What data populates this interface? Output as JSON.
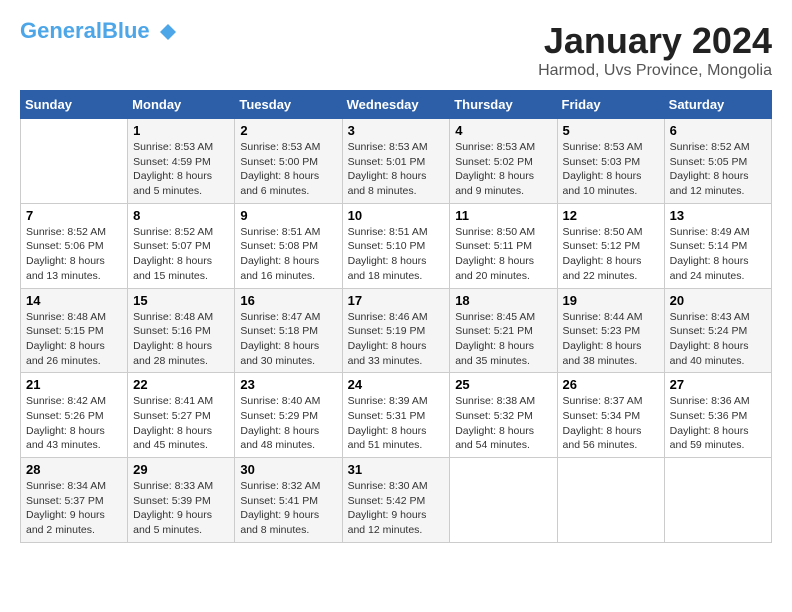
{
  "header": {
    "logo_general": "General",
    "logo_blue": "Blue",
    "logo_tagline": "",
    "month_title": "January 2024",
    "location": "Harmod, Uvs Province, Mongolia"
  },
  "calendar": {
    "days_of_week": [
      "Sunday",
      "Monday",
      "Tuesday",
      "Wednesday",
      "Thursday",
      "Friday",
      "Saturday"
    ],
    "weeks": [
      [
        {
          "day": "",
          "content": ""
        },
        {
          "day": "1",
          "content": "Sunrise: 8:53 AM\nSunset: 4:59 PM\nDaylight: 8 hours\nand 5 minutes."
        },
        {
          "day": "2",
          "content": "Sunrise: 8:53 AM\nSunset: 5:00 PM\nDaylight: 8 hours\nand 6 minutes."
        },
        {
          "day": "3",
          "content": "Sunrise: 8:53 AM\nSunset: 5:01 PM\nDaylight: 8 hours\nand 8 minutes."
        },
        {
          "day": "4",
          "content": "Sunrise: 8:53 AM\nSunset: 5:02 PM\nDaylight: 8 hours\nand 9 minutes."
        },
        {
          "day": "5",
          "content": "Sunrise: 8:53 AM\nSunset: 5:03 PM\nDaylight: 8 hours\nand 10 minutes."
        },
        {
          "day": "6",
          "content": "Sunrise: 8:52 AM\nSunset: 5:05 PM\nDaylight: 8 hours\nand 12 minutes."
        }
      ],
      [
        {
          "day": "7",
          "content": "Sunrise: 8:52 AM\nSunset: 5:06 PM\nDaylight: 8 hours\nand 13 minutes."
        },
        {
          "day": "8",
          "content": "Sunrise: 8:52 AM\nSunset: 5:07 PM\nDaylight: 8 hours\nand 15 minutes."
        },
        {
          "day": "9",
          "content": "Sunrise: 8:51 AM\nSunset: 5:08 PM\nDaylight: 8 hours\nand 16 minutes."
        },
        {
          "day": "10",
          "content": "Sunrise: 8:51 AM\nSunset: 5:10 PM\nDaylight: 8 hours\nand 18 minutes."
        },
        {
          "day": "11",
          "content": "Sunrise: 8:50 AM\nSunset: 5:11 PM\nDaylight: 8 hours\nand 20 minutes."
        },
        {
          "day": "12",
          "content": "Sunrise: 8:50 AM\nSunset: 5:12 PM\nDaylight: 8 hours\nand 22 minutes."
        },
        {
          "day": "13",
          "content": "Sunrise: 8:49 AM\nSunset: 5:14 PM\nDaylight: 8 hours\nand 24 minutes."
        }
      ],
      [
        {
          "day": "14",
          "content": "Sunrise: 8:48 AM\nSunset: 5:15 PM\nDaylight: 8 hours\nand 26 minutes."
        },
        {
          "day": "15",
          "content": "Sunrise: 8:48 AM\nSunset: 5:16 PM\nDaylight: 8 hours\nand 28 minutes."
        },
        {
          "day": "16",
          "content": "Sunrise: 8:47 AM\nSunset: 5:18 PM\nDaylight: 8 hours\nand 30 minutes."
        },
        {
          "day": "17",
          "content": "Sunrise: 8:46 AM\nSunset: 5:19 PM\nDaylight: 8 hours\nand 33 minutes."
        },
        {
          "day": "18",
          "content": "Sunrise: 8:45 AM\nSunset: 5:21 PM\nDaylight: 8 hours\nand 35 minutes."
        },
        {
          "day": "19",
          "content": "Sunrise: 8:44 AM\nSunset: 5:23 PM\nDaylight: 8 hours\nand 38 minutes."
        },
        {
          "day": "20",
          "content": "Sunrise: 8:43 AM\nSunset: 5:24 PM\nDaylight: 8 hours\nand 40 minutes."
        }
      ],
      [
        {
          "day": "21",
          "content": "Sunrise: 8:42 AM\nSunset: 5:26 PM\nDaylight: 8 hours\nand 43 minutes."
        },
        {
          "day": "22",
          "content": "Sunrise: 8:41 AM\nSunset: 5:27 PM\nDaylight: 8 hours\nand 45 minutes."
        },
        {
          "day": "23",
          "content": "Sunrise: 8:40 AM\nSunset: 5:29 PM\nDaylight: 8 hours\nand 48 minutes."
        },
        {
          "day": "24",
          "content": "Sunrise: 8:39 AM\nSunset: 5:31 PM\nDaylight: 8 hours\nand 51 minutes."
        },
        {
          "day": "25",
          "content": "Sunrise: 8:38 AM\nSunset: 5:32 PM\nDaylight: 8 hours\nand 54 minutes."
        },
        {
          "day": "26",
          "content": "Sunrise: 8:37 AM\nSunset: 5:34 PM\nDaylight: 8 hours\nand 56 minutes."
        },
        {
          "day": "27",
          "content": "Sunrise: 8:36 AM\nSunset: 5:36 PM\nDaylight: 8 hours\nand 59 minutes."
        }
      ],
      [
        {
          "day": "28",
          "content": "Sunrise: 8:34 AM\nSunset: 5:37 PM\nDaylight: 9 hours\nand 2 minutes."
        },
        {
          "day": "29",
          "content": "Sunrise: 8:33 AM\nSunset: 5:39 PM\nDaylight: 9 hours\nand 5 minutes."
        },
        {
          "day": "30",
          "content": "Sunrise: 8:32 AM\nSunset: 5:41 PM\nDaylight: 9 hours\nand 8 minutes."
        },
        {
          "day": "31",
          "content": "Sunrise: 8:30 AM\nSunset: 5:42 PM\nDaylight: 9 hours\nand 12 minutes."
        },
        {
          "day": "",
          "content": ""
        },
        {
          "day": "",
          "content": ""
        },
        {
          "day": "",
          "content": ""
        }
      ]
    ]
  }
}
